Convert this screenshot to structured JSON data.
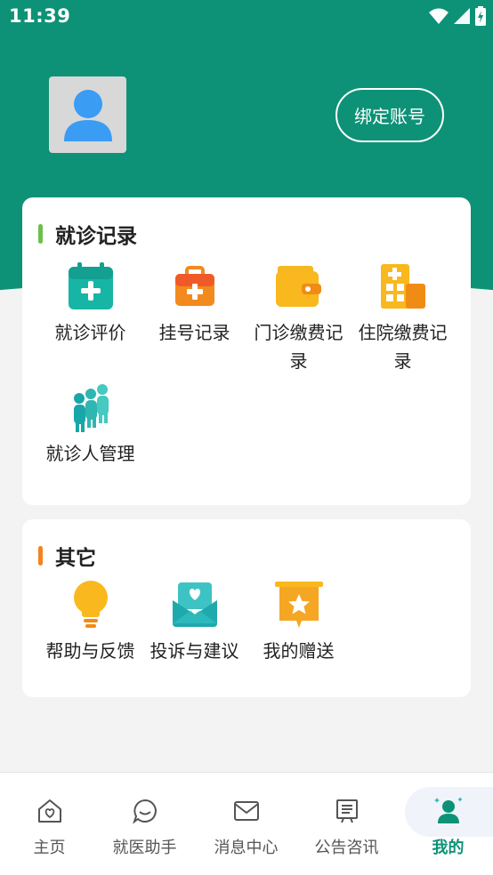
{
  "status_bar": {
    "time": "11:39"
  },
  "profile": {
    "bind_button": "绑定账号"
  },
  "visit_records": {
    "title": "就诊记录",
    "accent": "#6cc04a",
    "items": [
      {
        "label": "就诊评价",
        "icon": "calendar-plus-icon"
      },
      {
        "label": "挂号记录",
        "icon": "medical-kit-icon"
      },
      {
        "label": "门诊缴费记录",
        "icon": "wallet-icon"
      },
      {
        "label": "住院缴费记录",
        "icon": "hospital-icon"
      },
      {
        "label": "就诊人管理",
        "icon": "people-group-icon"
      }
    ]
  },
  "other": {
    "title": "其它",
    "accent": "#f5821f",
    "items": [
      {
        "label": "帮助与反馈",
        "icon": "lightbulb-icon"
      },
      {
        "label": "投诉与建议",
        "icon": "mail-heart-icon"
      },
      {
        "label": "我的赠送",
        "icon": "gift-star-icon"
      }
    ]
  },
  "nav": {
    "items": [
      {
        "label": "主页",
        "icon": "home-icon"
      },
      {
        "label": "就医助手",
        "icon": "chat-icon"
      },
      {
        "label": "消息中心",
        "icon": "envelope-icon"
      },
      {
        "label": "公告咨讯",
        "icon": "notice-board-icon"
      },
      {
        "label": "我的",
        "icon": "user-icon"
      }
    ],
    "active_index": 4
  },
  "colors": {
    "primary": "#0e9277",
    "background": "#f3f3f4"
  }
}
